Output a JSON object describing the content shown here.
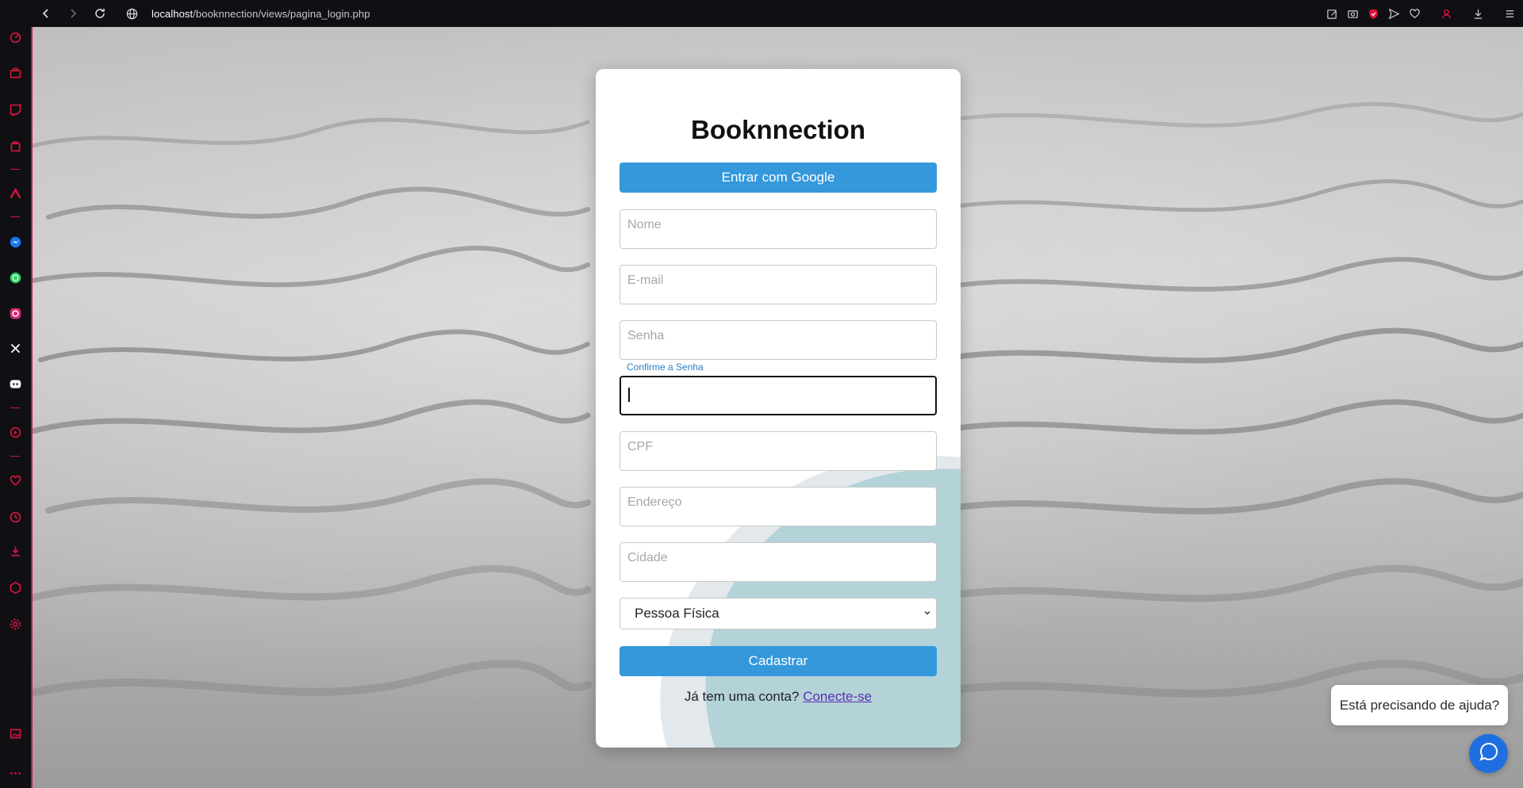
{
  "browser": {
    "url_host": "localhost",
    "url_path": "/booknnection/views/pagina_login.php",
    "nav_icons": [
      "back-icon",
      "forward-icon",
      "reload-icon",
      "globe-icon"
    ],
    "toolbar_icons": [
      "edit-icon",
      "camera-icon",
      "shield-icon",
      "send-icon",
      "heart-icon",
      "profile-icon",
      "download-icon",
      "menu-icon"
    ]
  },
  "sidebar": {
    "icons": [
      "speed-dial-icon",
      "briefcase-icon",
      "twitch-icon",
      "bag-icon",
      "vivaldi-icon",
      "messenger-icon",
      "whatsapp-icon",
      "instagram-icon",
      "x-icon",
      "discord-icon",
      "player-icon",
      "heart-icon",
      "history-icon",
      "download-icon",
      "cube-icon",
      "settings-icon",
      "gallery-icon",
      "more-icon"
    ]
  },
  "form": {
    "title": "Booknnection",
    "google_button": "Entrar com Google",
    "placeholders": {
      "nome": "Nome",
      "email": "E-mail",
      "senha": "Senha",
      "cpf": "CPF",
      "endereco": "Endereço",
      "cidade": "Cidade"
    },
    "confirm_label": "Confirme a Senha",
    "account_type": "Pessoa Física",
    "submit_button": "Cadastrar",
    "login_prompt": "Já tem uma conta?",
    "login_link": "Conecte-se"
  },
  "help": {
    "bubble_text": "Está precisando de ajuda?",
    "button_icon": "chat-icon"
  },
  "colors": {
    "primary": "#3498db",
    "accent_sidebar": "#d4143b",
    "link": "#5b2fae",
    "chat_button": "#1f6fe0"
  }
}
